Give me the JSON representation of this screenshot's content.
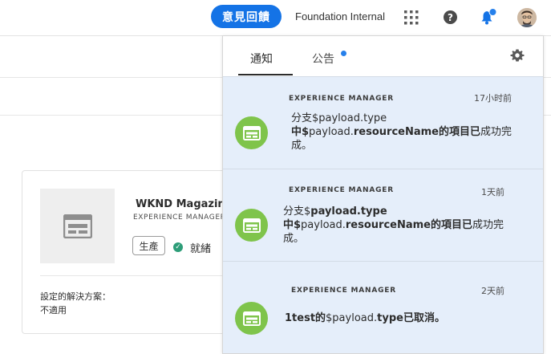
{
  "topbar": {
    "feedback_label": "意見回饋",
    "org_name": "Foundation Internal",
    "help_glyph": "?"
  },
  "card": {
    "title": "WKND Magazine",
    "subtitle": "EXPERIENCE MANAGER",
    "env_tag": "生產",
    "status": "就緒",
    "solution_label": "設定的解決方案：",
    "solution_value": "不適用"
  },
  "panel": {
    "tabs": [
      {
        "label": "通知",
        "active": true
      },
      {
        "label": "公告",
        "active": false,
        "has_badge": true
      }
    ],
    "notifications": [
      {
        "source": "EXPERIENCE MANAGER",
        "time": "17小时前",
        "line1": "分支$payload.type",
        "line2_a": "中$",
        "line2_b": "payload.",
        "line2_c": "resourceName",
        "line2_d": "的項目已",
        "line2_e": "成功完",
        "line3": "成。"
      },
      {
        "source": "EXPERIENCE MANAGER",
        "time": "1天前",
        "line1_a": "分支$",
        "line1_b": "payload.type",
        "line2_a": "中$",
        "line2_b": "payload.",
        "line2_c": "resourceName",
        "line2_d": "的項目已",
        "line2_e": "成功完",
        "line3": "成。"
      },
      {
        "source": "EXPERIENCE MANAGER",
        "time": "2天前",
        "line1_a": "1test的",
        "line1_b": "$payload.",
        "line1_c": "type",
        "line1_d": "已取消。"
      }
    ]
  },
  "colors": {
    "accent": "#1473e6",
    "notification_bg": "#e5eefa",
    "product_icon": "#7fc44b",
    "status_ok": "#2d9d78",
    "badge": "#2680eb"
  }
}
